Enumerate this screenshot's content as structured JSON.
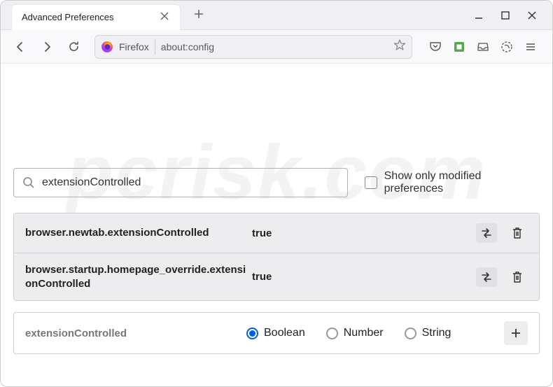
{
  "window": {
    "tab_title": "Advanced Preferences"
  },
  "toolbar": {
    "browser_label": "Firefox",
    "url": "about:config"
  },
  "search": {
    "value": "extensionControlled",
    "show_only_label": "Show only modified preferences"
  },
  "prefs": [
    {
      "name": "browser.newtab.extensionControlled",
      "value": "true"
    },
    {
      "name": "browser.startup.homepage_override.extensionControlled",
      "value": "true"
    }
  ],
  "add": {
    "name": "extensionControlled",
    "types": {
      "boolean": "Boolean",
      "number": "Number",
      "string": "String"
    },
    "selected": "boolean"
  },
  "watermark": "pcrisk.com"
}
